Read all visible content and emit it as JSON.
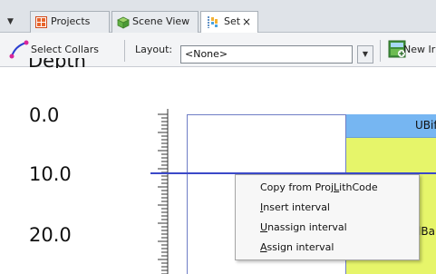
{
  "tabs": [
    {
      "label": "Projects",
      "icon": "grid-icon",
      "active": false
    },
    {
      "label": "Scene View",
      "icon": "cube-icon",
      "active": false
    },
    {
      "label": "Set",
      "icon": "bar-chart-icon",
      "active": true,
      "close": "×"
    }
  ],
  "toolbar": {
    "select_collars": "Select Collars",
    "layout_label": "Layout:",
    "layout_value": "<None>",
    "new_label": "New Ir"
  },
  "canvas": {
    "axis_title": "Depth",
    "depth_labels": [
      "0.0",
      "10.0",
      "20.0"
    ],
    "unit_top_label": "UBif",
    "unit_mid_label": "lBa"
  },
  "context_menu": [
    {
      "pre": "Copy from Proj",
      "u": "L",
      "post": "ithCode",
      "full": "Copy from ProjLithCode"
    },
    {
      "pre": "",
      "u": "I",
      "post": "nsert interval",
      "full": "Insert interval"
    },
    {
      "pre": "",
      "u": "U",
      "post": "nassign interval",
      "full": "Unassign interval"
    },
    {
      "pre": "",
      "u": "A",
      "post": "ssign interval",
      "full": "Assign interval"
    }
  ],
  "colors": {
    "unit_top": "#76b6f2",
    "unit_body": "#e6f56a",
    "cursor_line": "#3b49c8"
  }
}
